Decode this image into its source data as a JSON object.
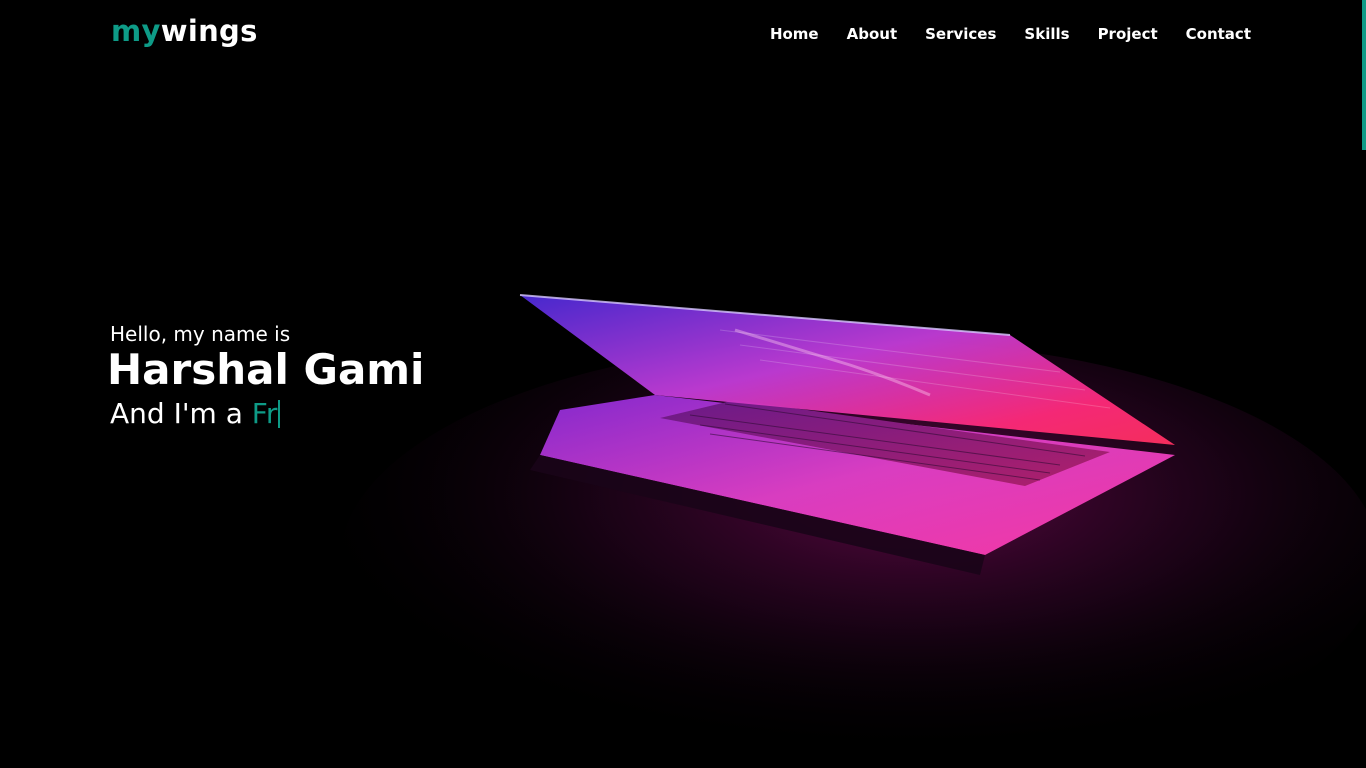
{
  "brand": {
    "prefix": "my",
    "suffix": "wings"
  },
  "nav": {
    "items": [
      {
        "label": "Home"
      },
      {
        "label": "About"
      },
      {
        "label": "Services"
      },
      {
        "label": "Skills"
      },
      {
        "label": "Project"
      },
      {
        "label": "Contact"
      }
    ]
  },
  "hero": {
    "greeting": "Hello, my name is",
    "name": "Harshal Gami",
    "role_prefix": "And I'm a",
    "role_typed": "Fr",
    "image_icon": "laptop-glow-image"
  },
  "colors": {
    "accent": "#0e9b87",
    "background": "#000000",
    "text": "#ffffff"
  }
}
